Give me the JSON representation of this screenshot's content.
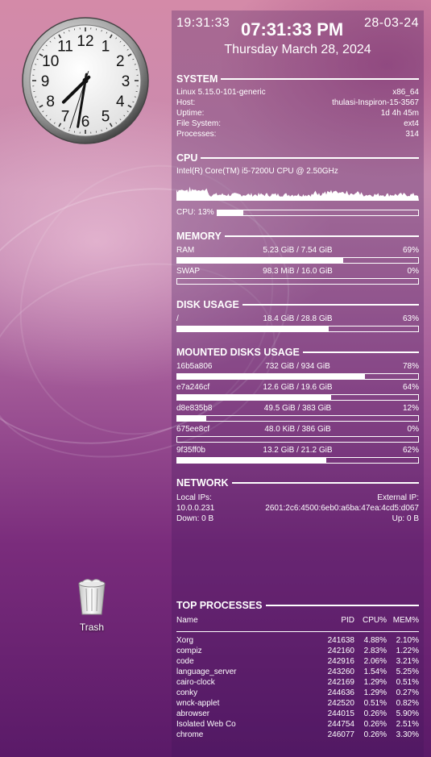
{
  "clock": {
    "hour": 7,
    "minute": 31,
    "second": 33,
    "numerals": [
      "12",
      "1",
      "2",
      "3",
      "4",
      "5",
      "6",
      "7",
      "8",
      "9",
      "10",
      "11"
    ]
  },
  "desktop": {
    "trash_label": "Trash"
  },
  "header": {
    "time_24": "19:31:33",
    "time_12": "07:31:33 PM",
    "date_short": "28-03-24",
    "date_long": "Thursday March 28, 2024"
  },
  "system": {
    "title": "SYSTEM",
    "kernel": "Linux 5.15.0-101-generic",
    "arch": "x86_64",
    "host_label": "Host:",
    "host": "thulasi-Inspiron-15-3567",
    "uptime_label": "Uptime:",
    "uptime": "1d 4h 45m",
    "fs_label": "File System:",
    "fs": "ext4",
    "proc_label": "Processes:",
    "processes": "314"
  },
  "cpu": {
    "title": "CPU",
    "model": "Intel(R) Core(TM) i5-7200U CPU @ 2.50GHz",
    "usage_label": "CPU: 13%",
    "usage_fraction": 0.13
  },
  "memory": {
    "title": "MEMORY",
    "ram_label": "RAM",
    "ram_value": "5.23 GiB / 7.54 GiB",
    "ram_percent": "69%",
    "ram_fraction": 0.69,
    "swap_label": "SWAP",
    "swap_value": "98.3 MiB / 16.0 GiB",
    "swap_percent": "0%",
    "swap_fraction": 0.0
  },
  "disk": {
    "title": "DISK USAGE",
    "mount": "/",
    "value": "18.4 GiB / 28.8 GiB",
    "percent": "63%",
    "fraction": 0.63
  },
  "mounted": {
    "title": "MOUNTED DISKS USAGE",
    "disks": [
      {
        "name": "16b5a806",
        "value": "732 GiB / 934 GiB",
        "percent": "78%",
        "fraction": 0.78
      },
      {
        "name": "e7a246cf",
        "value": "12.6 GiB / 19.6 GiB",
        "percent": "64%",
        "fraction": 0.64
      },
      {
        "name": "d8e835b8",
        "value": "49.5 GiB / 383 GiB",
        "percent": "12%",
        "fraction": 0.12
      },
      {
        "name": "675ee8cf",
        "value": "48.0 KiB / 386 GiB",
        "percent": "0%",
        "fraction": 0.0
      },
      {
        "name": "9f35ff0b",
        "value": "13.2 GiB / 21.2 GiB",
        "percent": "62%",
        "fraction": 0.62
      }
    ]
  },
  "network": {
    "title": "NETWORK",
    "local_label": "Local IPs:",
    "external_label": "External IP:",
    "local_ip": "10.0.0.231",
    "external_ip": "2601:2c6:4500:6eb0:a6ba:47ea:4cd5:d067",
    "down": "Down: 0 B",
    "up": "Up: 0 B"
  },
  "processes": {
    "title": "TOP PROCESSES",
    "columns": {
      "name": "Name",
      "pid": "PID",
      "cpu": "CPU%",
      "mem": "MEM%"
    },
    "rows": [
      {
        "name": "Xorg",
        "pid": "241638",
        "cpu": "4.88%",
        "mem": "2.10%"
      },
      {
        "name": "compiz",
        "pid": "242160",
        "cpu": "2.83%",
        "mem": "1.22%"
      },
      {
        "name": "code",
        "pid": "242916",
        "cpu": "2.06%",
        "mem": "3.21%"
      },
      {
        "name": "language_server",
        "pid": "243260",
        "cpu": "1.54%",
        "mem": "5.25%"
      },
      {
        "name": "cairo-clock",
        "pid": "242169",
        "cpu": "1.29%",
        "mem": "0.51%"
      },
      {
        "name": "conky",
        "pid": "244636",
        "cpu": "1.29%",
        "mem": "0.27%"
      },
      {
        "name": "wnck-applet",
        "pid": "242520",
        "cpu": "0.51%",
        "mem": "0.82%"
      },
      {
        "name": "abrowser",
        "pid": "244015",
        "cpu": "0.26%",
        "mem": "5.90%"
      },
      {
        "name": "Isolated Web Co",
        "pid": "244754",
        "cpu": "0.26%",
        "mem": "2.51%"
      },
      {
        "name": "chrome",
        "pid": "246077",
        "cpu": "0.26%",
        "mem": "3.30%"
      }
    ]
  }
}
